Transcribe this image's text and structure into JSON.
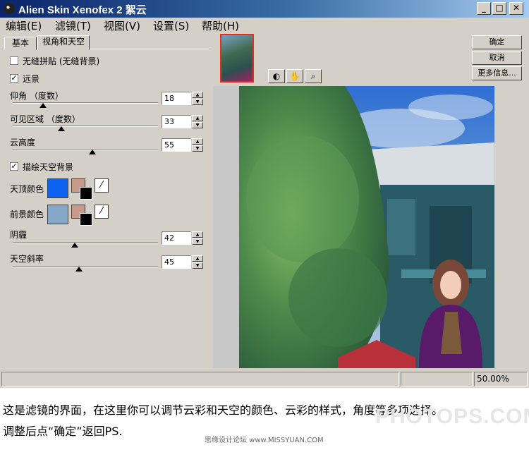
{
  "window": {
    "title": "Alien Skin Xenofex 2 絮云",
    "controls": {
      "minimize": "_",
      "maximize": "□",
      "close": "✕"
    }
  },
  "menu": [
    "编辑(E)",
    "滤镜(T)",
    "视图(V)",
    "设置(S)",
    "帮助(H)"
  ],
  "tabs": [
    "基本",
    "视角和天空"
  ],
  "panel": {
    "seamless_label": "无缝拼贴 (无缝背景)",
    "seamless_checked": false,
    "distant_label": "远景",
    "distant_checked": true,
    "pitch_label": "仰角 （度数）",
    "pitch_value": "18",
    "fov_label": "可见区域 （度数）",
    "fov_value": "33",
    "cloud_height_label": "云高度",
    "cloud_height_value": "55",
    "draw_sky_label": "描绘天空背景",
    "draw_sky_checked": true,
    "zenith_color_label": "天顶颜色",
    "foreground_color_label": "前景颜色",
    "shadow_label": "阴霾",
    "shadow_value": "42",
    "sky_slope_label": "天空斜率",
    "sky_slope_value": "45"
  },
  "colors": {
    "zenith": "#0d62f0",
    "foreground": "#86a8c8",
    "pair_back": "#c89a8a"
  },
  "buttons": {
    "ok": "确定",
    "cancel": "取消",
    "more_info": "更多信息..."
  },
  "tools": [
    "preview-toggle-icon",
    "hand-icon",
    "zoom-icon"
  ],
  "status": {
    "zoom": "50.00%"
  },
  "caption": {
    "line1": "这是滤镜的界面，在这里你可以调节云彩和天空的颜色、云彩的样式，角度等多项选择。",
    "line2": "调整后点“确定”返回PS."
  },
  "watermark": "PHOTOPS.COM",
  "credit": "思缘设计论坛 www.MISSYUAN.COM"
}
